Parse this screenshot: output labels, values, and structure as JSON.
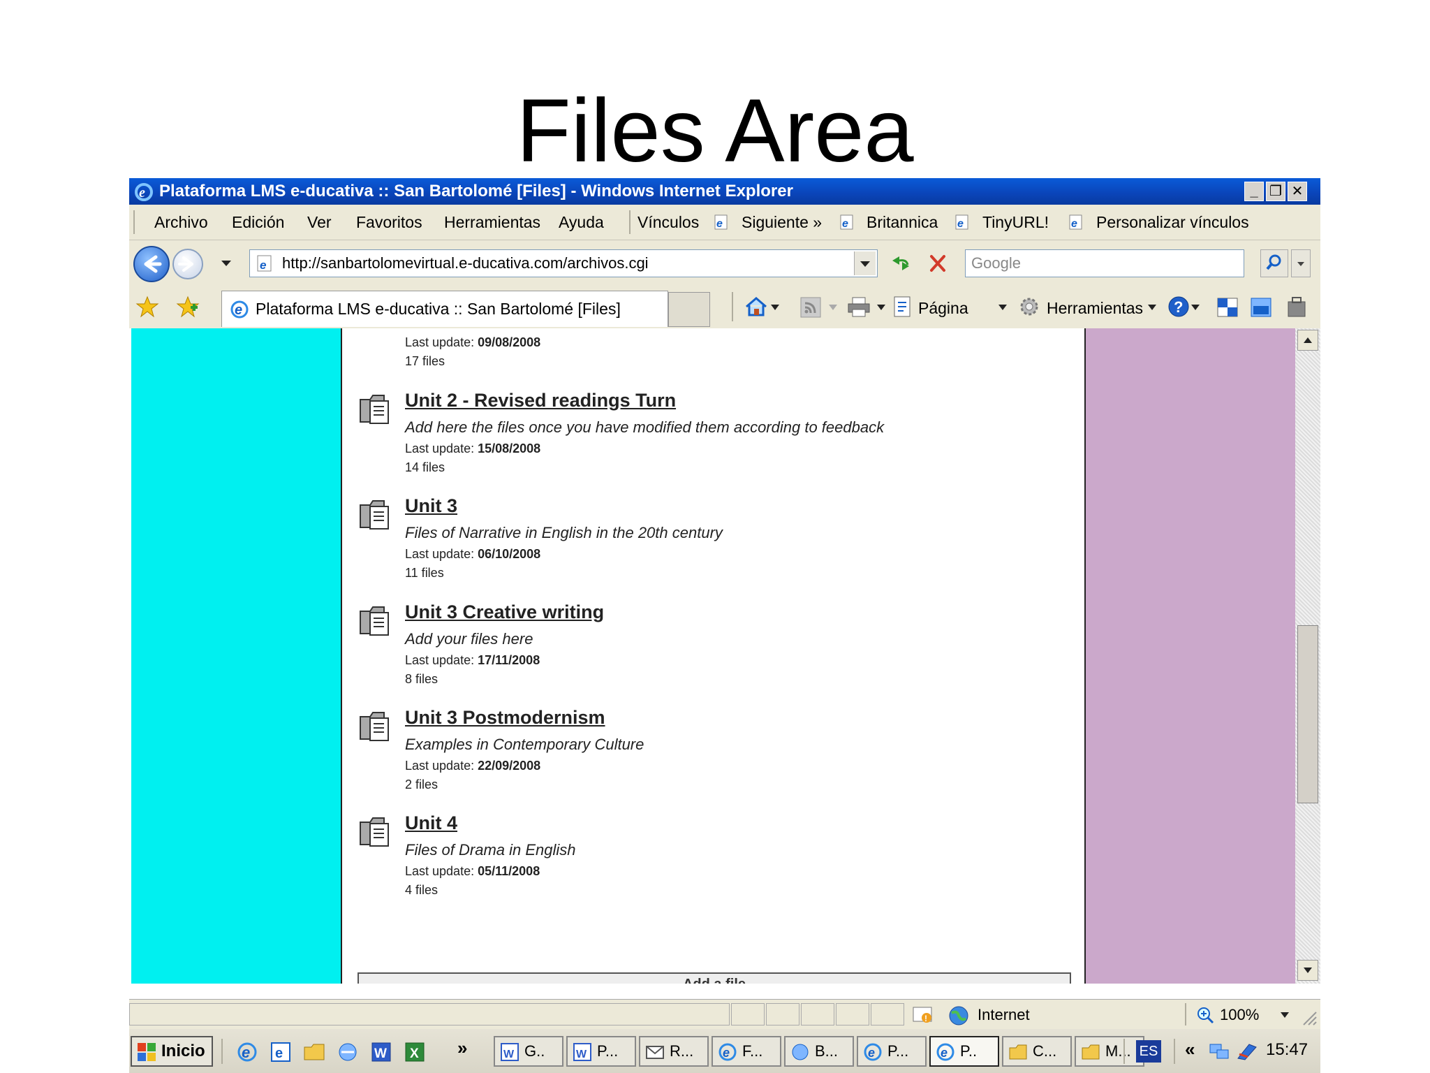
{
  "slide": {
    "title": "Files Area"
  },
  "window": {
    "title": "Plataforma LMS e-ducativa :: San Bartolomé [Files] - Windows Internet Explorer",
    "controls": {
      "minimize": "_",
      "restore": "❐",
      "close": "✕"
    }
  },
  "menu": {
    "items": [
      "Archivo",
      "Edición",
      "Ver",
      "Favoritos",
      "Herramientas",
      "Ayuda"
    ],
    "links_label": "Vínculos",
    "links": [
      "Siguiente »",
      "Britannica",
      "TinyURL!",
      "Personalizar vínculos"
    ]
  },
  "address": {
    "url": "http://sanbartolomevirtual.e-ducativa.com/archivos.cgi",
    "search_placeholder": "Google"
  },
  "tab": {
    "title": "Plataforma LMS e-ducativa :: San Bartolomé [Files]"
  },
  "command_bar": {
    "page_label": "Página",
    "tools_label": "Herramientas"
  },
  "files": {
    "top_meta": {
      "last_update_label": "Last update:",
      "last_update": "09/08/2008",
      "count": "17 files"
    },
    "folders": [
      {
        "title": "Unit 2 - Revised readings Turn",
        "description": "Add here the files once you have modified them according to feedback",
        "last_update_label": "Last update:",
        "last_update": "15/08/2008",
        "count": "14 files"
      },
      {
        "title": "Unit 3",
        "description": "Files of Narrative in English in the 20th century",
        "last_update_label": "Last update:",
        "last_update": "06/10/2008",
        "count": "11 files"
      },
      {
        "title": "Unit 3 Creative writing",
        "description": "Add your files here",
        "last_update_label": "Last update:",
        "last_update": "17/11/2008",
        "count": "8 files"
      },
      {
        "title": "Unit 3 Postmodernism",
        "description": "Examples in Contemporary Culture",
        "last_update_label": "Last update:",
        "last_update": "22/09/2008",
        "count": "2 files"
      },
      {
        "title": "Unit 4",
        "description": "Files of Drama in English",
        "last_update_label": "Last update:",
        "last_update": "05/11/2008",
        "count": "4 files"
      }
    ],
    "add_button": "Add a file"
  },
  "status": {
    "zone": "Internet",
    "zoom": "100%"
  },
  "taskbar": {
    "start": "Inicio",
    "chevron": "»",
    "buttons": [
      "G..",
      "P...",
      "R...",
      "F...",
      "B...",
      "P...",
      "P..",
      "C...",
      "M..."
    ],
    "active_index": 6,
    "lang": "ES",
    "tray_chevron": "«",
    "clock": "15:47"
  },
  "colors": {
    "left_column": "#00f0f0",
    "right_column": "#cba8cb",
    "titlebar": "#0a50c8"
  }
}
